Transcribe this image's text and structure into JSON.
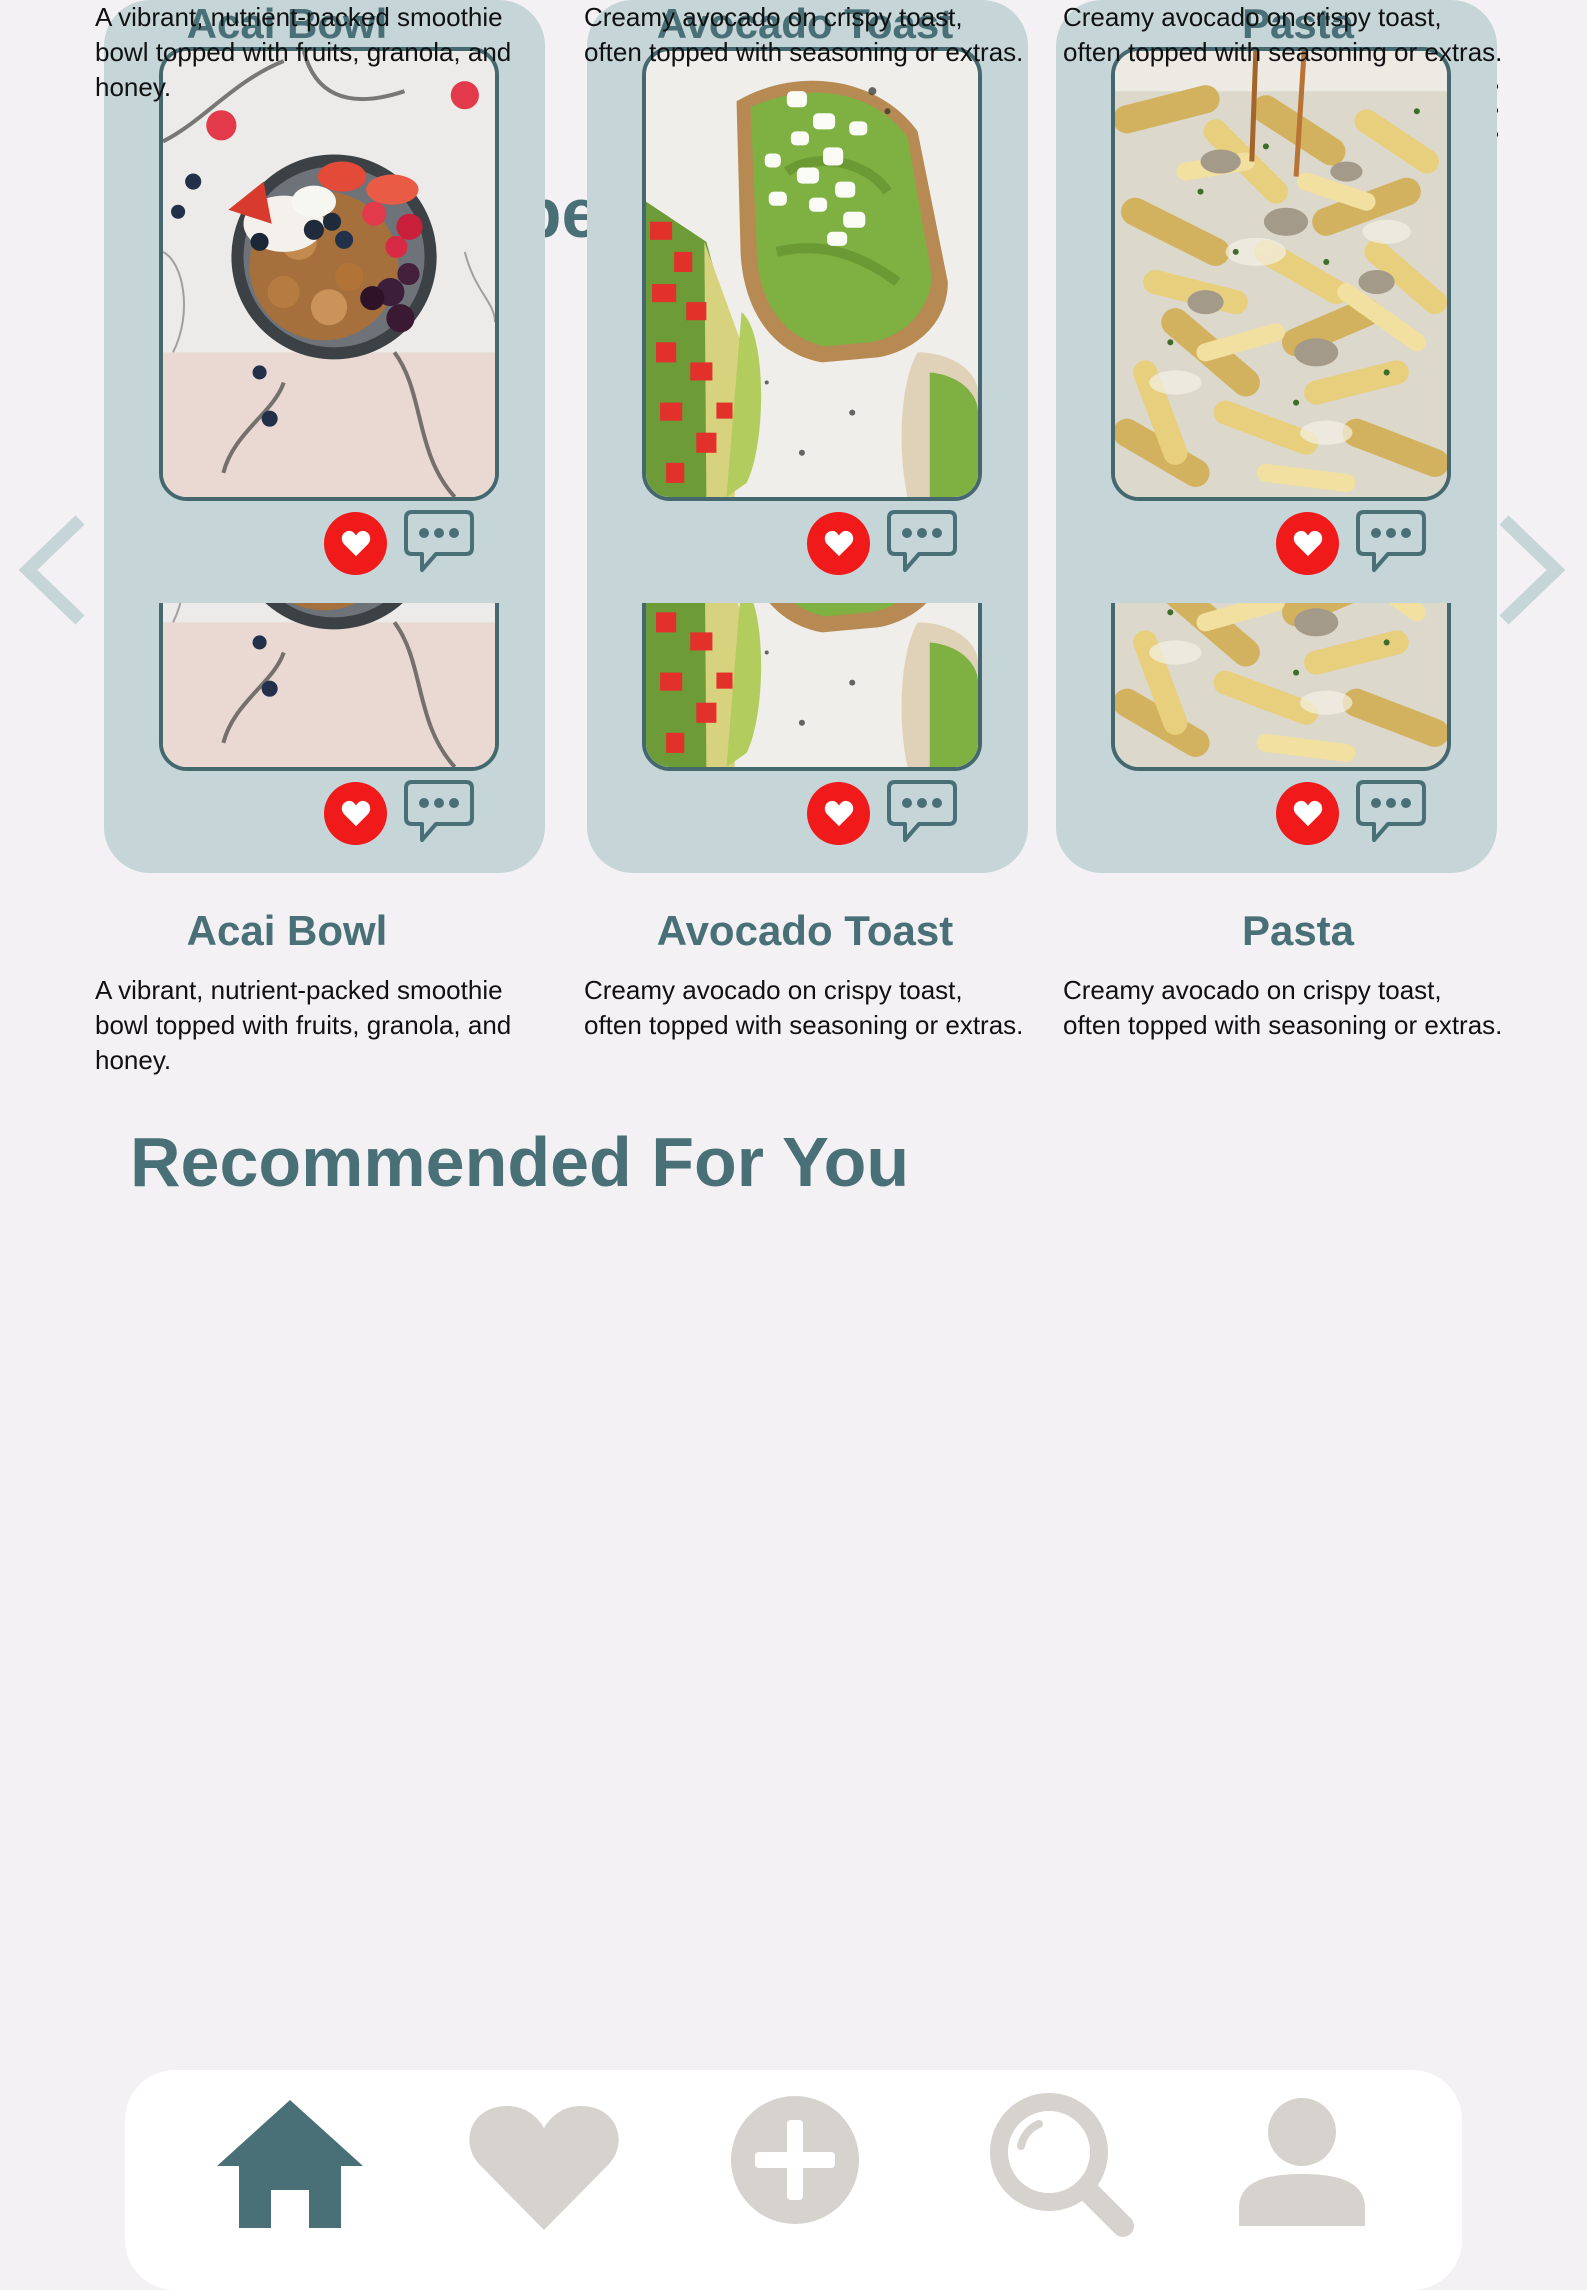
{
  "header": {
    "menu_icon": "hamburger-menu-icon"
  },
  "sections": {
    "top": {
      "title": "Top 5 Recipes",
      "recipes": [
        {
          "name": "Acai Bowl",
          "description": "A vibrant, nutrient-packed smoothie bowl topped with fruits, granola, and honey.",
          "image": "acai-bowl-photo"
        },
        {
          "name": "Avocado Toast",
          "description": "Creamy avocado on crispy toast, often topped with seasoning or extras.",
          "image": "avocado-toast-photo"
        },
        {
          "name": "Pasta",
          "description": "Creamy avocado on crispy toast, often topped with seasoning or extras.",
          "image": "pasta-photo"
        }
      ]
    },
    "recommended": {
      "title": "Recommended For You",
      "recipes": [
        {
          "name": "Acai Bowl",
          "description": "A vibrant, nutrient-packed smoothie bowl topped with fruits, granola, and honey.",
          "image": "acai-bowl-photo"
        },
        {
          "name": "Avocado Toast",
          "description": "Creamy avocado on crispy toast, often topped with seasoning or extras.",
          "image": "avocado-toast-photo"
        },
        {
          "name": "Pasta",
          "description": "Creamy avocado on crispy toast, often topped with seasoning or extras.",
          "image": "pasta-photo"
        }
      ]
    }
  },
  "card_icons": {
    "like": "heart-icon",
    "comment": "comment-icon"
  },
  "carousel": {
    "prev_icon": "chevron-left-icon",
    "next_icon": "chevron-right-icon"
  },
  "bottom_nav": {
    "items": [
      {
        "icon": "home-icon",
        "active": true
      },
      {
        "icon": "heart-icon",
        "active": false
      },
      {
        "icon": "add-icon",
        "active": false
      },
      {
        "icon": "search-icon",
        "active": false
      },
      {
        "icon": "profile-icon",
        "active": false
      }
    ]
  },
  "colors": {
    "background": "#f3f1f4",
    "accent": "#4a7077",
    "card": "#c5d5d8",
    "like": "#f11a1a",
    "nav_inactive": "#d6d3cf",
    "nav_active": "#4a7077"
  }
}
